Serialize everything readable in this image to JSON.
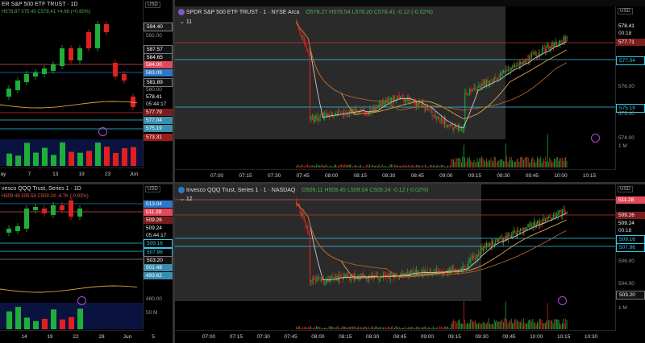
{
  "colors": {
    "up": "#1fae3a",
    "down": "#e02020",
    "cyan": "#36c8e8",
    "red_line": "#c0392b",
    "premarket": "#2a2a2a",
    "bg": "#000000",
    "vol_bg": "#0a1240"
  },
  "p1": {
    "title": "ER S&P 500 ETF TRUST · 1D",
    "ohlc": "H578.87  575.40  C578.41  +4.68 (+0.80%)",
    "usd": "USD",
    "ticks": [
      "594.40",
      "592.00",
      "587.57",
      "584.65",
      "584.00",
      "583.09",
      "581.89",
      "580.00",
      "578.41",
      "05:44:17",
      "577.79",
      "577.04",
      "575.19",
      "573.31"
    ],
    "xlabels": [
      "ay",
      "7",
      "13",
      "19",
      "23",
      "Jun"
    ]
  },
  "p2": {
    "title": "SPDR S&P 500 ETF TRUST · 1 · NYSE Arca",
    "ohlc": "O578.27  H578.54  L578.20  C578.41  -0.12 (-0.02%)",
    "usd": "USD",
    "badge": "11",
    "ticks": [
      "578.41",
      "00:18",
      "577.71",
      "577.04",
      "576.00",
      "575.19",
      "575.00",
      "574.00",
      "1 M"
    ],
    "xlabels": [
      "07:00",
      "07:15",
      "07:30",
      "07:45",
      "08:00",
      "08:15",
      "08:30",
      "08:45",
      "09:00",
      "09:15",
      "09:30",
      "09:45",
      "10:00",
      "10:15"
    ]
  },
  "p3": {
    "title": "vesco QQQ Trust, Series 1 · 1D",
    "ohlc": "H509.48  505.58  C509.24  -4.7K (-0.93%)",
    "usd": "USD",
    "ticks": [
      "513.04",
      "511.28",
      "509.26",
      "509.24",
      "05:44:17",
      "509.16",
      "507.86",
      "503.20",
      "501.48",
      "493.62",
      "480.00",
      "50 M"
    ],
    "xlabels": [
      "14",
      "19",
      "22",
      "28",
      "Jun",
      "5"
    ]
  },
  "p4": {
    "title": "Invesco QQQ Trust, Series 1 · 1 · NASDAQ",
    "ohlc": "O509.11  H509.45  L509.04  C509.24  -0.12 (-0.02%)",
    "usd": "USD",
    "badge": "12",
    "ticks": [
      "511.28",
      "509.26",
      "509.24",
      "00:18",
      "509.16",
      "507.86",
      "506.00",
      "504.00",
      "503.20",
      "1 M"
    ],
    "xlabels": [
      "07:00",
      "07:15",
      "07:30",
      "07:45",
      "08:00",
      "08:15",
      "08:30",
      "08:45",
      "09:00",
      "09:15",
      "09:30",
      "09:45",
      "10:00",
      "10:15",
      "10:30"
    ]
  },
  "icons": [
    "clock-alert-icon"
  ]
}
